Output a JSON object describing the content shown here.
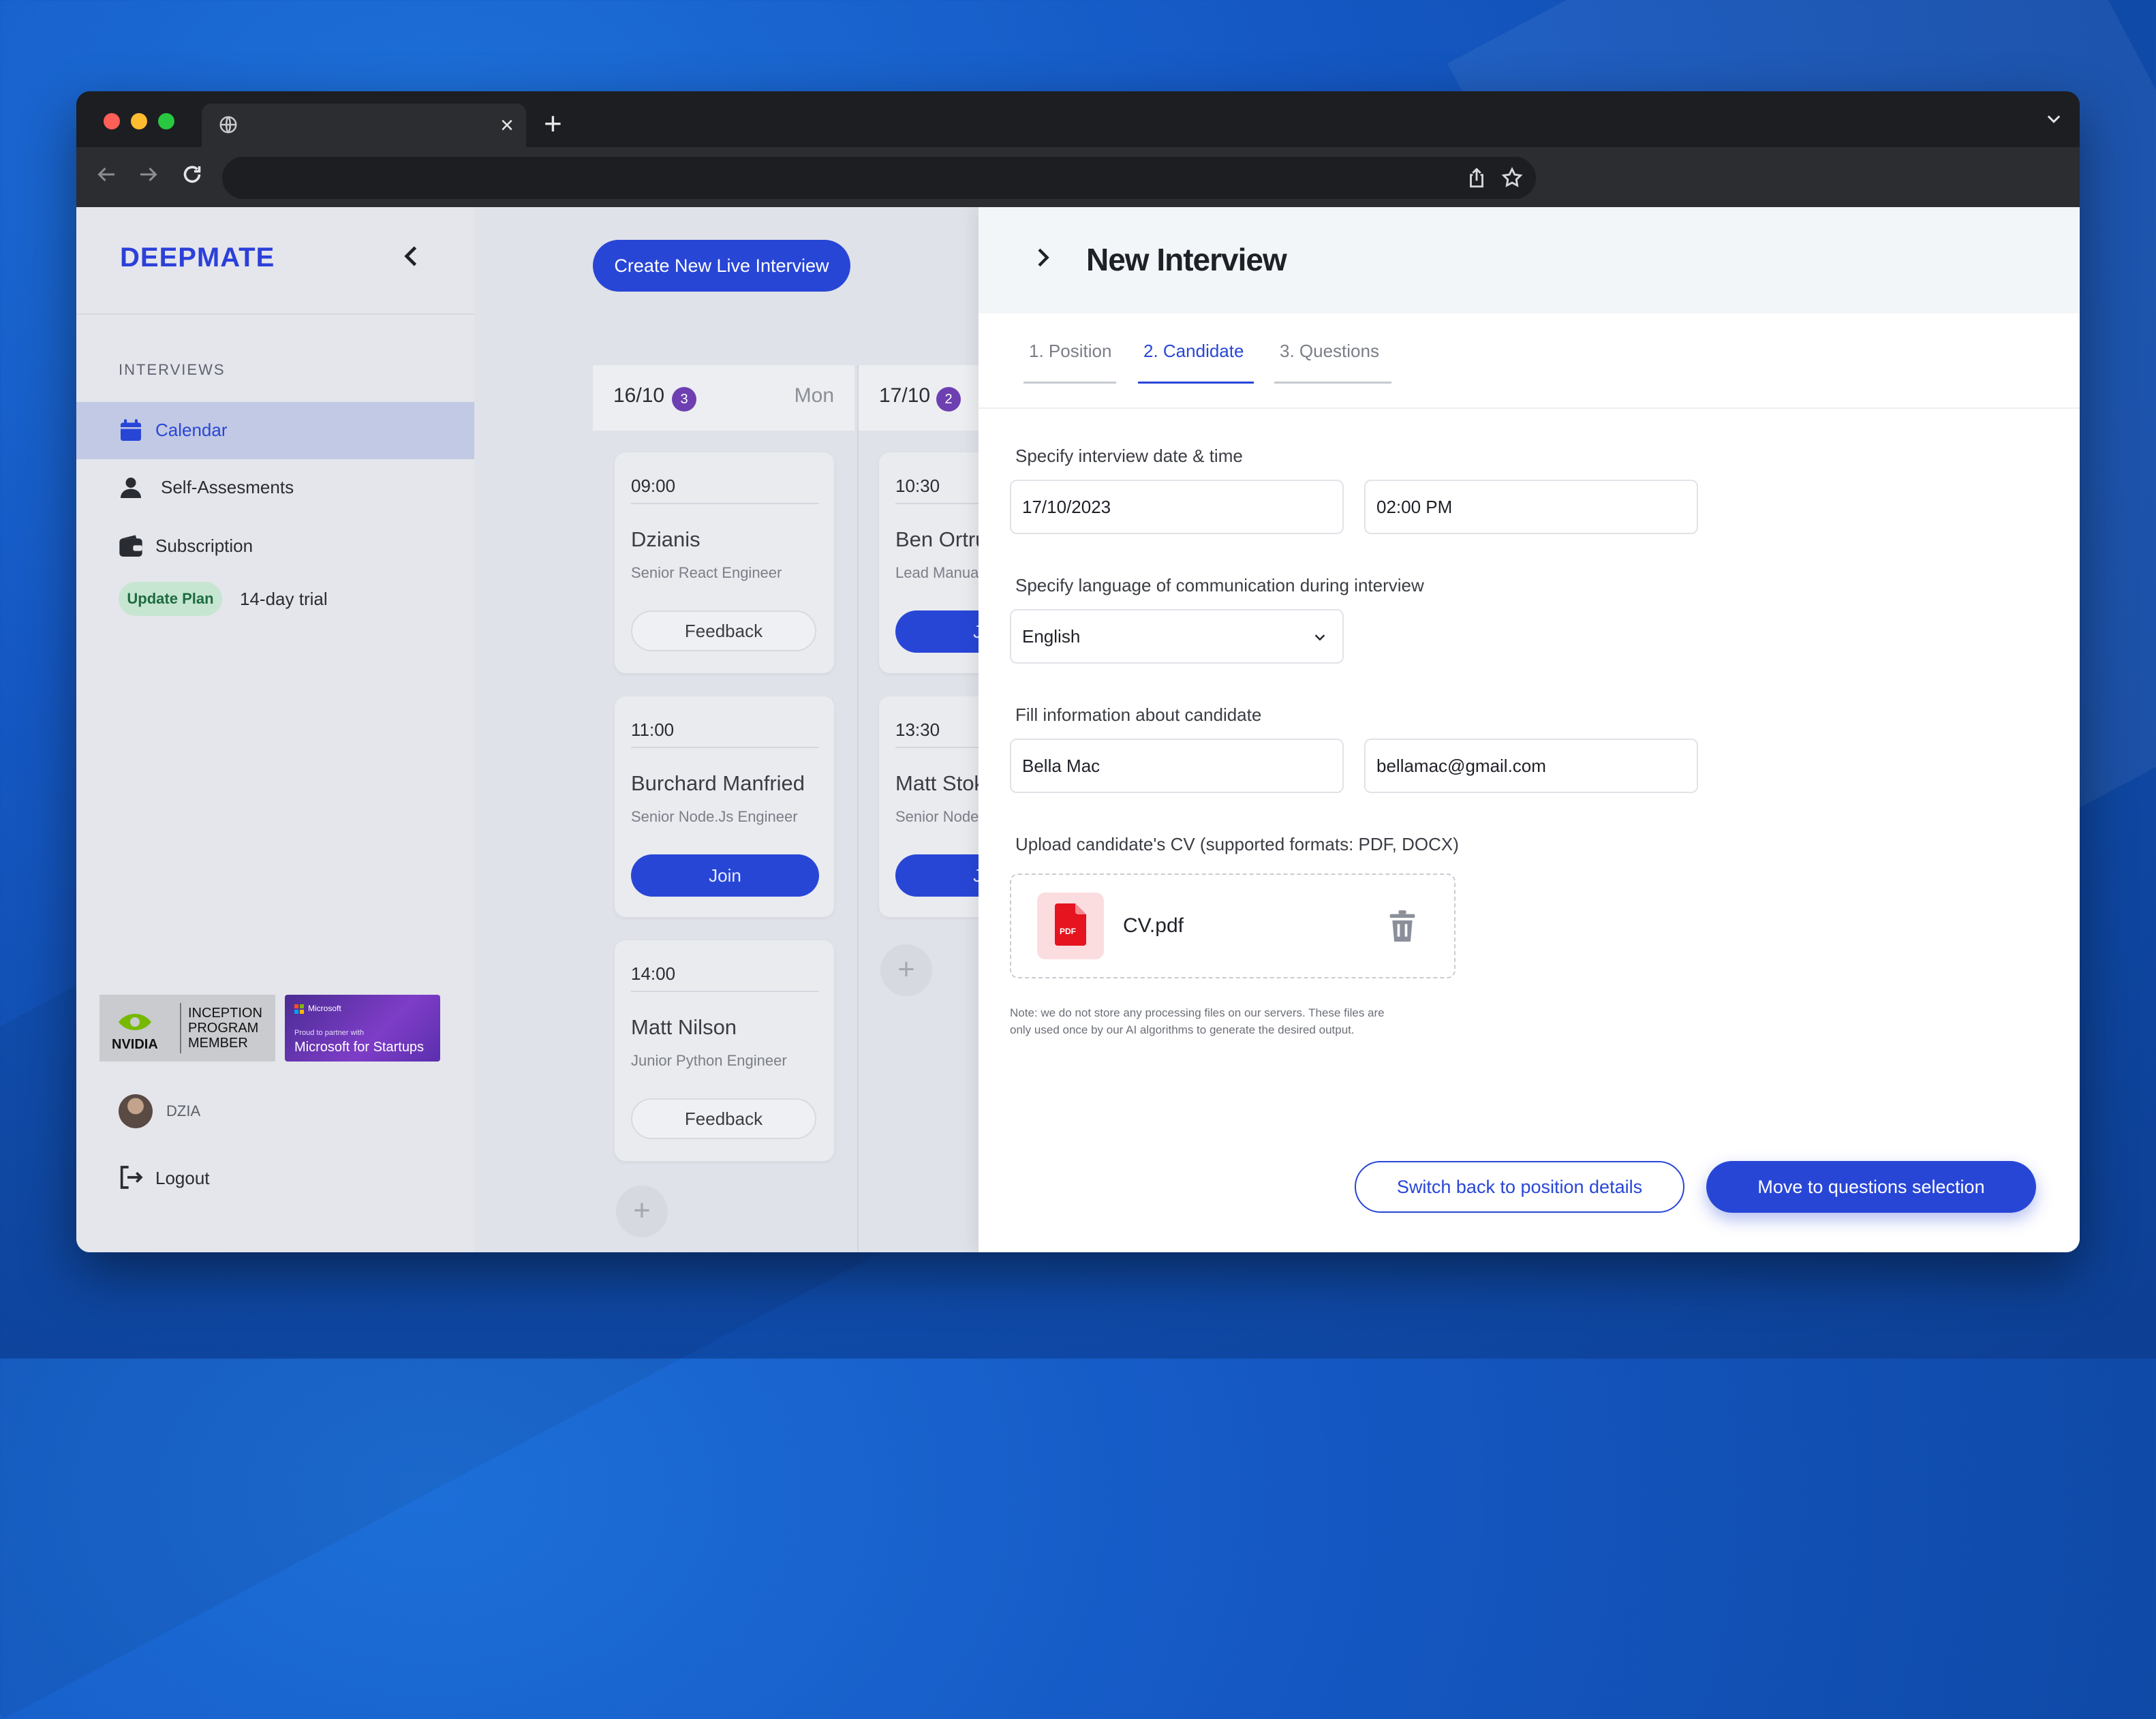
{
  "sidebar": {
    "logo": "DEEPMATE",
    "section_label": "INTERVIEWS",
    "items": [
      {
        "label": "Calendar"
      },
      {
        "label": "Self-Assesments"
      },
      {
        "label": "Subscription"
      }
    ],
    "update_plan": "Update Plan",
    "trial": "14-day trial",
    "nvidia": {
      "brand": "NVIDIA",
      "lines": [
        "INCEPTION",
        "PROGRAM",
        "MEMBER"
      ]
    },
    "microsoft": {
      "brand": "Microsoft",
      "small": "Proud to partner with",
      "title": "Microsoft for Startups"
    },
    "user": "DZIA",
    "logout": "Logout"
  },
  "calendar": {
    "create_button": "Create New Live Interview",
    "days": [
      {
        "date": "16/10",
        "count": "3",
        "weekday": "Mon",
        "cards": [
          {
            "time": "09:00",
            "name": "Dzianis",
            "role": "Senior React Engineer",
            "action": "Feedback"
          },
          {
            "time": "11:00",
            "name": "Burchard Manfried",
            "role": "Senior Node.Js Engineer",
            "action": "Join"
          },
          {
            "time": "14:00",
            "name": "Matt Nilson",
            "role": "Junior Python Engineer",
            "action": "Feedback"
          }
        ]
      },
      {
        "date": "17/10",
        "count": "2",
        "weekday": "",
        "cards": [
          {
            "time": "10:30",
            "name": "Ben Ortrun",
            "role": "Lead Manual QA",
            "action": "Join"
          },
          {
            "time": "13:30",
            "name": "Matt Stoker",
            "role": "Senior Node.Js Engineer",
            "action": "Join"
          }
        ]
      }
    ],
    "add_symbol": "+"
  },
  "panel": {
    "title": "New Interview",
    "steps": [
      {
        "label": "1. Position",
        "active": false
      },
      {
        "label": "2. Candidate",
        "active": true
      },
      {
        "label": "3. Questions",
        "active": false
      }
    ],
    "datetime_label": "Specify interview date & time",
    "date": "17/10/2023",
    "time": "02:00 PM",
    "language_label": "Specify language of communication during interview",
    "language": "English",
    "candidate_label": "Fill information about candidate",
    "candidate_name": "Bella Mac",
    "candidate_email": "bellamac@gmail.com",
    "cv_label": "Upload candidate's CV (supported formats: PDF, DOCX)",
    "file_badge": "PDF",
    "file_name": "CV.pdf",
    "note": "Note: we do not store any processing files on our servers. These files are only used once by our AI algorithms to generate the desired output.",
    "back_button": "Switch back to position details",
    "next_button": "Move to questions selection"
  },
  "browser": {
    "tab_close": "×",
    "new_tab": "+"
  },
  "colors": {
    "accent": "#2846d6",
    "badge": "#6d3fb1",
    "plan": "#c7e6d2"
  }
}
